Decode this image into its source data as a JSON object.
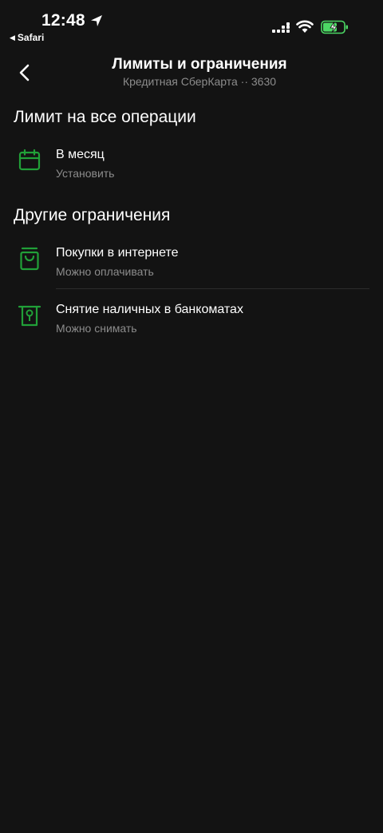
{
  "status_bar": {
    "time": "12:48",
    "back_app": "Safari",
    "icons": [
      "location-arrow-icon",
      "cellular-signal-icon",
      "wifi-icon",
      "battery-charging-icon"
    ]
  },
  "header": {
    "title": "Лимиты и ограничения",
    "subtitle": "Кредитная СберКарта ·· 3630"
  },
  "sections": [
    {
      "title": "Лимит на все операции",
      "items": [
        {
          "title": "В месяц",
          "subtitle": "Установить",
          "icon": "calendar-icon"
        }
      ]
    },
    {
      "title": "Другие ограничения",
      "items": [
        {
          "title": "Покупки в интернете",
          "subtitle": "Можно оплачивать",
          "icon": "shopping-bag-icon"
        },
        {
          "title": "Снятие наличных в банкоматах",
          "subtitle": "Можно снимать",
          "icon": "atm-icon"
        }
      ]
    }
  ],
  "colors": {
    "background": "#131313",
    "accent": "#21a038",
    "text_primary": "#ffffff",
    "text_secondary": "#8c8c8c",
    "battery_fill": "#4cd964"
  }
}
